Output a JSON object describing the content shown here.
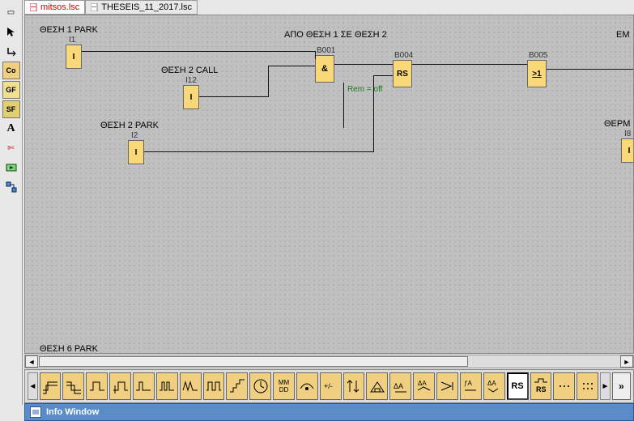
{
  "tabs": [
    {
      "label": "mitsos.lsc",
      "active": true
    },
    {
      "label": "THESEIS_11_2017.lsc",
      "active": false
    }
  ],
  "left_tools": {
    "window": "▭",
    "arrow": "↖",
    "connector": "↳",
    "co": "Co",
    "gf": "GF",
    "sf": "SF",
    "text": "A",
    "cut": "✄",
    "sim": "▶",
    "net": "⊞"
  },
  "canvas": {
    "labels": {
      "thesi1_park": "ΘΕΣΗ 1 PARK",
      "apo_thesi": "ΑΠΟ ΘΕΣΗ 1 ΣΕ ΘΕΣΗ 2",
      "thesi2_call": "ΘΕΣΗ 2 CALL",
      "thesi2_park": "ΘΕΣΗ 2 PARK",
      "thesi6_park": "ΘΕΣΗ 6 PARK",
      "em": "EM",
      "therm": "ΘΕΡΜ"
    },
    "blocks": {
      "i1": {
        "id": "I1",
        "sym": "I"
      },
      "i12": {
        "id": "I12",
        "sym": "I"
      },
      "i2": {
        "id": "I2",
        "sym": "I"
      },
      "i8": {
        "id": "I8",
        "sym": "I"
      },
      "b001": {
        "id": "B001",
        "sym": "&"
      },
      "b004": {
        "id": "B004",
        "sym": "RS"
      },
      "b005": {
        "id": "B005",
        "sym": ">1"
      }
    },
    "rem": "Rem = off"
  },
  "bottom_tool_icons": [
    "pulse-hi",
    "pulse-lo",
    "edge-up",
    "edge-dn",
    "wave1",
    "wave2",
    "edge-a",
    "edge-b",
    "multi",
    "clock",
    "mm-dd",
    "pm",
    "plus-minus",
    "updn",
    "house",
    "delta-a",
    "ramp",
    "arrow",
    "ia",
    "dia",
    "rs",
    "rs2",
    "dots1",
    "dots2"
  ],
  "bottom_labels": {
    "mmdd": "MM\nDD",
    "rs": "RS",
    "rs2": "RS",
    "more": "»"
  },
  "info_window": "Info Window"
}
